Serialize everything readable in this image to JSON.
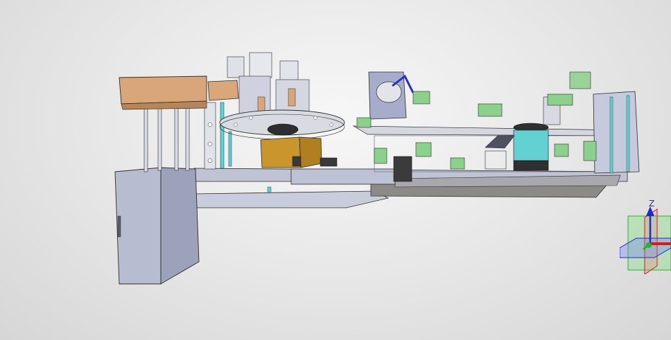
{
  "viewport": {
    "background_top": "#f7f7f7",
    "background_bottom": "#d6d6d6"
  },
  "model": {
    "colors": {
      "frame": "#b9bfd3",
      "frame_dark": "#8e94aa",
      "cabinet": "#c3c8db",
      "copper": "#d8a679",
      "gold": "#c9962e",
      "teal": "#5fd1d4",
      "green": "#8bd08b",
      "blue_accent": "#1f2fd0",
      "edge": "#2a2a2a"
    }
  },
  "triad": {
    "z_label": "Z",
    "colors": {
      "x": "#e01515",
      "y": "#1fb81f",
      "z": "#1a2ad6"
    }
  }
}
